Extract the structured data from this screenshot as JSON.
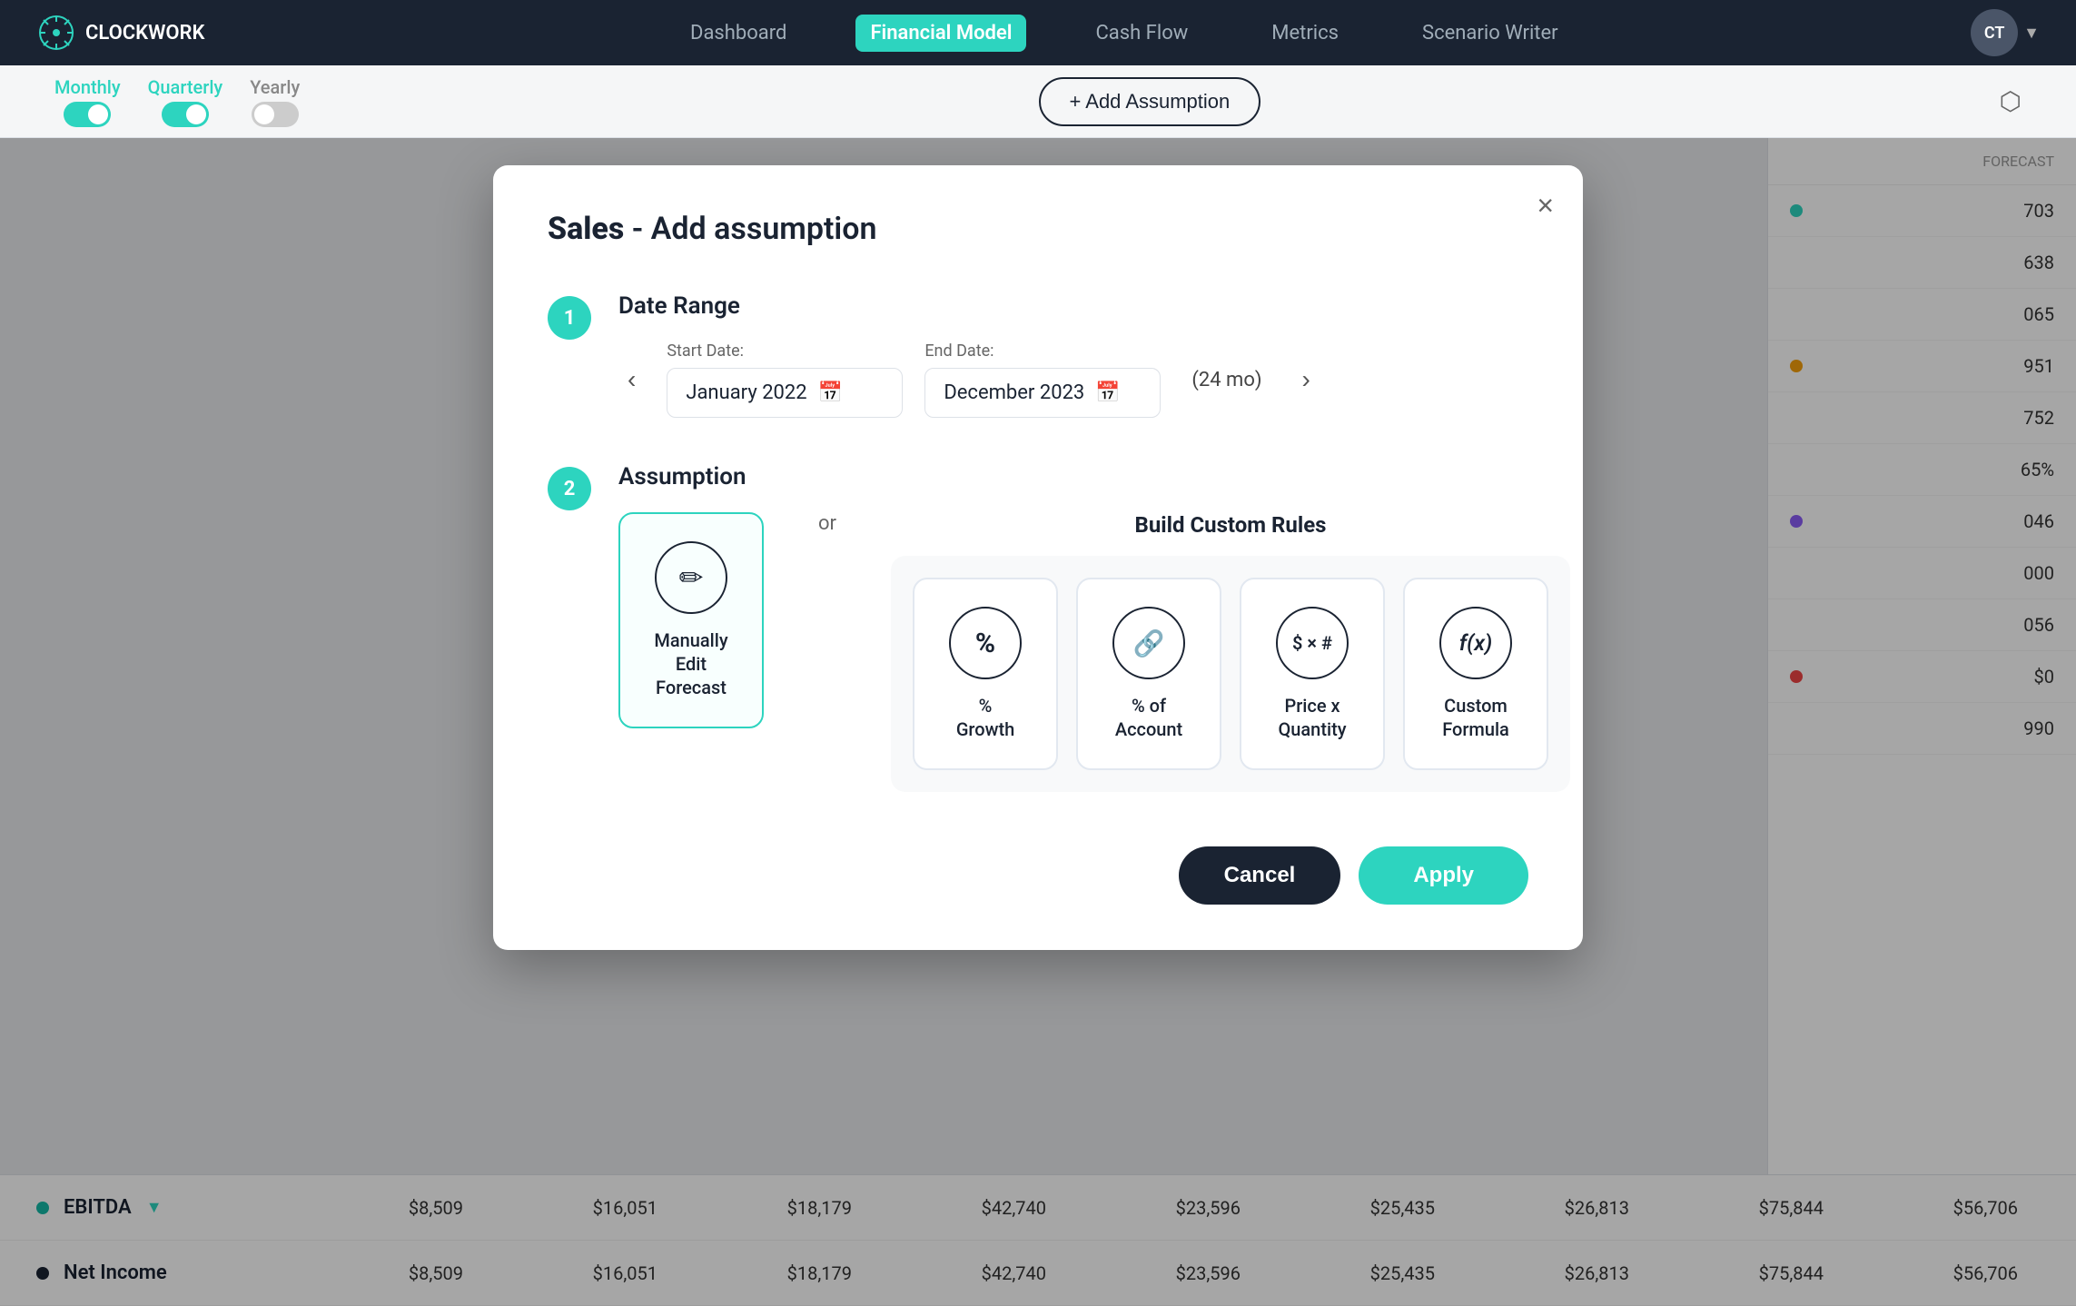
{
  "nav": {
    "logo_text": "CLOCKWORK",
    "links": [
      {
        "label": "Dashboard",
        "active": false
      },
      {
        "label": "Financial Model",
        "active": true
      },
      {
        "label": "Cash Flow",
        "active": false
      },
      {
        "label": "Metrics",
        "active": false
      },
      {
        "label": "Scenario Writer",
        "active": false
      }
    ],
    "avatar_initials": "CT"
  },
  "toolbar": {
    "toggles": [
      {
        "label": "Monthly",
        "active": true
      },
      {
        "label": "Quarterly",
        "active": true
      },
      {
        "label": "Yearly",
        "active": false
      }
    ],
    "add_assumption_label": "+ Add Assumption"
  },
  "modal": {
    "title_bold": "Sales",
    "title_rest": " - Add assumption",
    "close_icon": "×",
    "step1": {
      "number": "1",
      "title": "Date Range",
      "start_label": "Start Date:",
      "start_value": "January 2022",
      "end_label": "End Date:",
      "end_value": "December 2023",
      "duration": "(24 mo)"
    },
    "step2": {
      "number": "2",
      "title": "Assumption",
      "custom_rules_title": "Build Custom Rules",
      "manual_option": {
        "icon": "✏",
        "label": "Manually Edit\nForecast"
      },
      "or_text": "or",
      "custom_options": [
        {
          "icon": "%",
          "label": "% Growth"
        },
        {
          "icon": "🔗",
          "label": "% of Account"
        },
        {
          "icon": "$ × #",
          "label": "Price x Quantity"
        },
        {
          "icon": "f(x)",
          "label": "Custom Formula"
        }
      ]
    }
  },
  "modal_footer": {
    "cancel_label": "Cancel",
    "apply_label": "Apply"
  },
  "bottom_table": {
    "rows": [
      {
        "dot_color": "teal",
        "label": "EBITDA",
        "chevron": true,
        "values": [
          "$8,509",
          "$16,051",
          "$18,179",
          "$42,740",
          "$23,596",
          "$25,435",
          "$26,813",
          "$75,844",
          "$56,706"
        ]
      },
      {
        "dot_color": "dark",
        "label": "Net Income",
        "chevron": false,
        "values": [
          "$8,509",
          "$16,051",
          "$18,179",
          "$42,740",
          "$23,596",
          "$25,435",
          "$26,813",
          "$75,844",
          "$56,706"
        ]
      }
    ]
  },
  "right_sidebar": {
    "header": "FORECAST",
    "rows": [
      {
        "dot": "green",
        "value": "703"
      },
      {
        "dot": null,
        "value": "638"
      },
      {
        "dot": null,
        "value": "065"
      },
      {
        "dot": "orange",
        "value": "951"
      },
      {
        "dot": null,
        "value": "752"
      },
      {
        "dot": null,
        "value": "65%"
      },
      {
        "dot": "purple",
        "value": "046"
      },
      {
        "dot": null,
        "value": "000"
      },
      {
        "dot": null,
        "value": "056"
      },
      {
        "dot": "red",
        "value": "$0"
      },
      {
        "dot": null,
        "value": "990"
      }
    ]
  }
}
